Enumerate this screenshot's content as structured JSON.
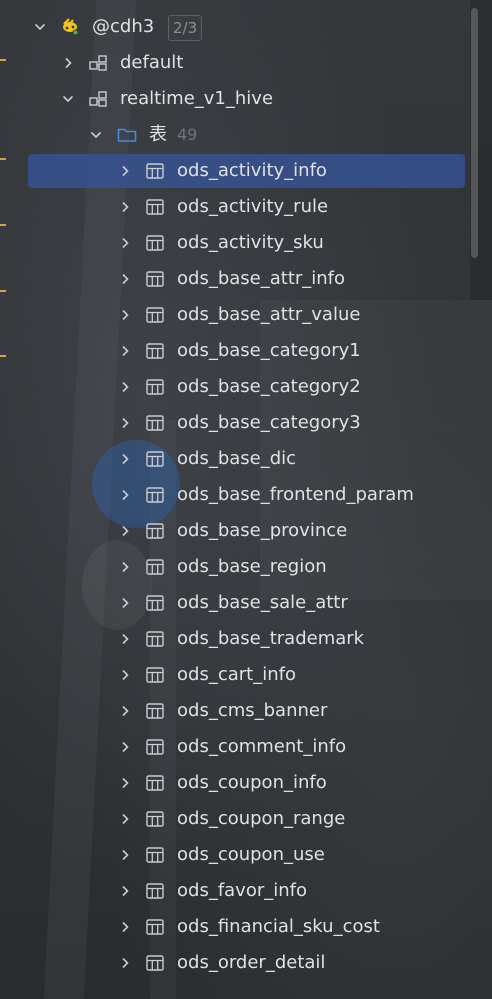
{
  "tree": {
    "connection": {
      "label": "@cdh3",
      "badge": "2/3"
    },
    "schemas": [
      {
        "label": "default",
        "expanded": false
      },
      {
        "label": "realtime_v1_hive",
        "expanded": true
      }
    ],
    "folder": {
      "label": "表",
      "count": "49"
    },
    "tables": [
      "ods_activity_info",
      "ods_activity_rule",
      "ods_activity_sku",
      "ods_base_attr_info",
      "ods_base_attr_value",
      "ods_base_category1",
      "ods_base_category2",
      "ods_base_category3",
      "ods_base_dic",
      "ods_base_frontend_param",
      "ods_base_province",
      "ods_base_region",
      "ods_base_sale_attr",
      "ods_base_trademark",
      "ods_cart_info",
      "ods_cms_banner",
      "ods_comment_info",
      "ods_coupon_info",
      "ods_coupon_range",
      "ods_coupon_use",
      "ods_favor_info",
      "ods_financial_sku_cost",
      "ods_order_detail"
    ],
    "selected_table": "ods_activity_info"
  },
  "colors": {
    "background": "#2b2d30",
    "text": "#dfe1e5",
    "selection": "#365498",
    "folder_icon": "#3d8ee6",
    "hive_icon": "#f0c419",
    "gutter_marks": "#d9a343"
  },
  "icons": {
    "connection": "hive-bee-icon",
    "schema": "schema-icon",
    "folder": "folder-icon",
    "table": "table-icon",
    "collapsed": "chevron-right-icon",
    "expanded": "chevron-down-icon"
  }
}
